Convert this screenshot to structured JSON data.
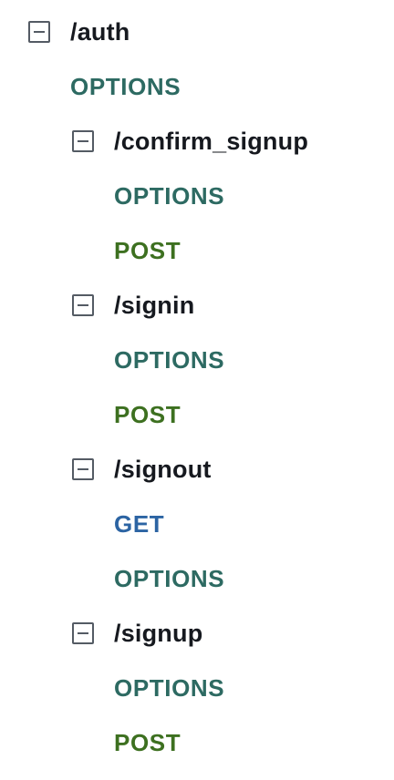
{
  "tree": {
    "auth": {
      "path": "/auth",
      "options": "OPTIONS"
    },
    "confirm_signup": {
      "path": "/confirm_signup",
      "options": "OPTIONS",
      "post": "POST"
    },
    "signin": {
      "path": "/signin",
      "options": "OPTIONS",
      "post": "POST"
    },
    "signout": {
      "path": "/signout",
      "get": "GET",
      "options": "OPTIONS"
    },
    "signup": {
      "path": "/signup",
      "options": "OPTIONS",
      "post": "POST"
    }
  },
  "colors": {
    "options": "#2d6a62",
    "post": "#3d7020",
    "get": "#2c64a3",
    "path_text": "#16191f",
    "toggle_border": "#545b64"
  },
  "icons": {
    "toggle": "minus-square-icon"
  }
}
